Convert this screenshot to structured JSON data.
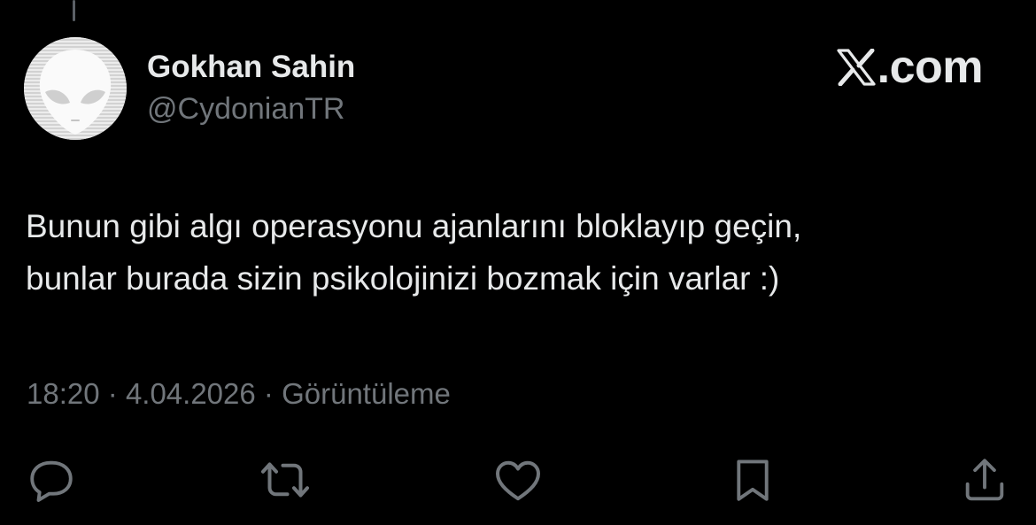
{
  "tweet": {
    "author": {
      "display_name": "Gokhan Sahin",
      "handle": "@CydonianTR",
      "avatar_icon": "alien-head-icon"
    },
    "brand": {
      "label": ".com",
      "logo_icon": "x-logo-icon"
    },
    "text_lines": [
      "Bunun gibi algı operasyonu ajanlarını bloklayıp geçin,",
      "bunlar burada sizin psikolojinizi bozmak için varlar :)"
    ],
    "meta": {
      "time": "18:20",
      "date": "4.04.2026",
      "views_label": "Görüntüleme",
      "separator": "·"
    },
    "actions": [
      {
        "name": "reply",
        "icon": "reply-icon"
      },
      {
        "name": "repost",
        "icon": "repost-icon"
      },
      {
        "name": "like",
        "icon": "heart-icon"
      },
      {
        "name": "bookmark",
        "icon": "bookmark-icon"
      },
      {
        "name": "share",
        "icon": "share-icon"
      }
    ]
  },
  "colors": {
    "background": "#000000",
    "text_primary": "#e7e9ea",
    "text_secondary": "#71767b"
  }
}
